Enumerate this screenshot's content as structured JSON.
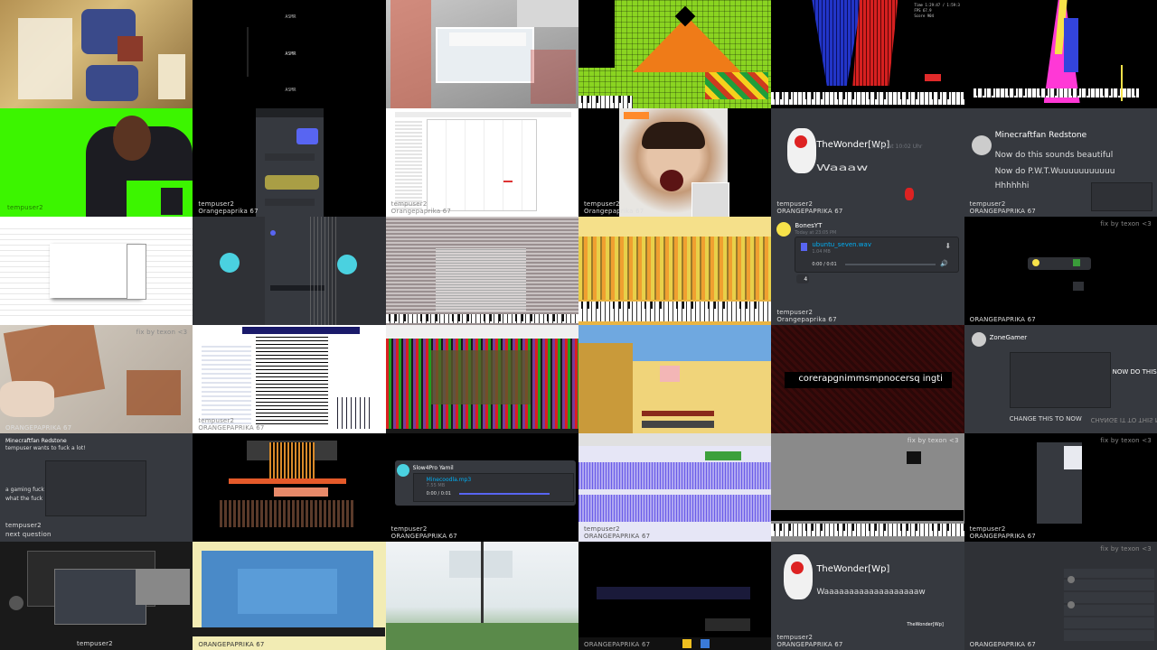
{
  "captions": {
    "tempuser": "tempuser2",
    "orange": "Orangepaprika 67",
    "orange_caps": "ORANGEPAPRIKA 67",
    "fix": "fix by texon <3",
    "tempuser_mirror": "tempuser2"
  },
  "tiles": {
    "t1": {
      "label": "room-scene"
    },
    "t2": {
      "top": "ASMR",
      "mid": "ASMR",
      "bottom": "ASMR"
    },
    "t4": {
      "label": "pixel-art"
    },
    "t5": {
      "stats": [
        "Time 1:29:47 / 1:59:3",
        "FPS 67.9",
        "Score 904"
      ]
    },
    "t13": {
      "name": "BonesYT",
      "time": "Today at 23:05 PM",
      "file": "ubuntu_seven.wav",
      "size": "1.04 MB",
      "player": "0:00 / 0:01"
    },
    "t12": {
      "badge": "4"
    },
    "t17": {
      "title": "Minecraftfan Redstone",
      "line1": "Now do this sounds beautiful",
      "line2": "Now do P.W.T.Wuuuuuuuuuuu",
      "line3": "Hhhhhhi"
    },
    "t16": {
      "title": "TheWonder[Wp]",
      "subtitle": "Today at 10:02 Uhr",
      "body": "Waaaw"
    },
    "t22": {
      "text": "corerapgnimmsmpnocersq ingti"
    },
    "t23": {
      "user": "ZoneGamer",
      "headline": "CHANGE THIS TO NOW",
      "mirror": "CHANGE IT TO THIS NOW",
      "side": "NOW DO THIS"
    },
    "t25": {
      "title": "Minecraftfan Redstone",
      "line1": "tempuser wants to fuck a lot!",
      "line2": "a gaming fuck",
      "line3": "what the fuck",
      "footer": "next question"
    },
    "t27": {
      "name": "Slow4Pro Yamil",
      "file": "Minecoodla.mp3",
      "size": "7.55 MB",
      "player": "0:00 / 0:01"
    },
    "t34": {
      "title": "TheWonder[Wp]",
      "body": "Waaaaaaaaaaaaaaaaaaaw",
      "badge": "TheWonder[Wp]"
    }
  },
  "colors": {
    "green_screen": "#3cf500",
    "discord_bg": "#36393f",
    "discord_dark": "#2f3136",
    "discord_blurple": "#5865f2",
    "pink": "#ff38d6",
    "yellow": "#f7e24a"
  }
}
